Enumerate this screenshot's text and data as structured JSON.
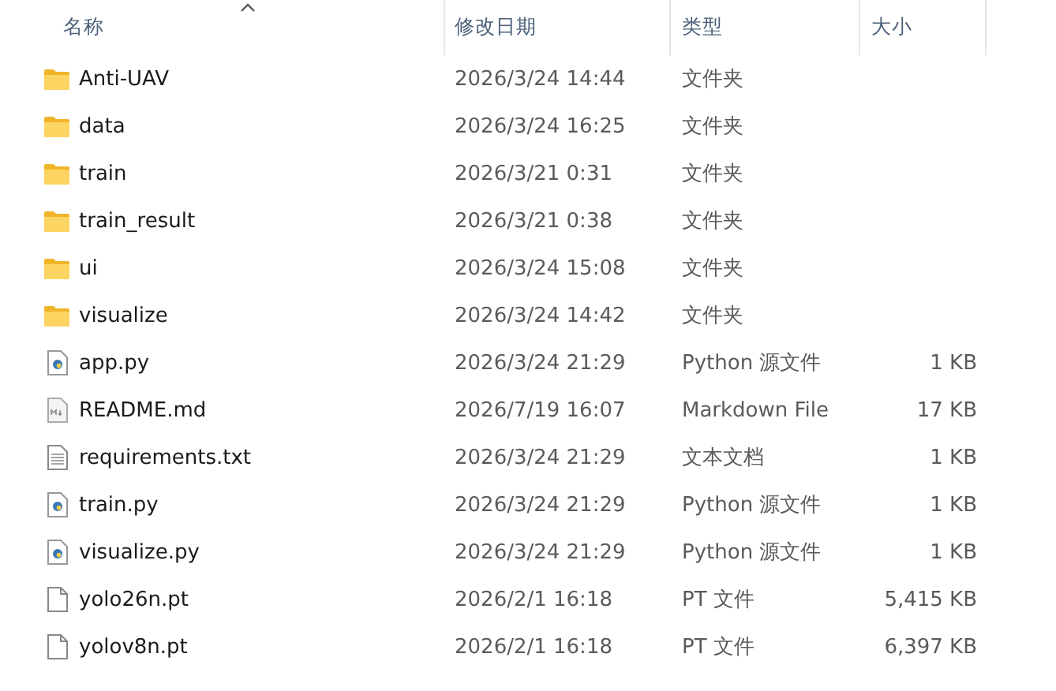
{
  "columns": [
    {
      "label": "名称",
      "sorted": true
    },
    {
      "label": "修改日期",
      "sorted": false
    },
    {
      "label": "类型",
      "sorted": false
    },
    {
      "label": "大小",
      "sorted": false
    }
  ],
  "rows": [
    {
      "kind": "folder",
      "name": "Anti-UAV",
      "date": "2026/3/24 14:44",
      "type": "文件夹"
    },
    {
      "kind": "folder",
      "name": "data",
      "date": "2026/3/24 16:25",
      "type": "文件夹"
    },
    {
      "kind": "folder",
      "name": "train",
      "date": "2026/3/21 0:31",
      "type": "文件夹"
    },
    {
      "kind": "folder",
      "name": "train_result",
      "date": "2026/3/21 0:38",
      "type": "文件夹"
    },
    {
      "kind": "folder",
      "name": "ui",
      "date": "2026/3/24 15:08",
      "type": "文件夹"
    },
    {
      "kind": "folder",
      "name": "visualize",
      "date": "2026/3/24 14:42",
      "type": "文件夹"
    },
    {
      "kind": "python",
      "name": "app.py",
      "date": "2026/3/24 21:29",
      "type": "Python 源文件",
      "size": "1 KB"
    },
    {
      "kind": "markdown",
      "name": "README.md",
      "date": "2026/7/19 16:07",
      "type": "Markdown File",
      "size": "17 KB"
    },
    {
      "kind": "text",
      "name": "requirements.txt",
      "date": "2026/3/24 21:29",
      "type": "文本文档",
      "size": "1 KB"
    },
    {
      "kind": "python",
      "name": "train.py",
      "date": "2026/3/24 21:29",
      "type": "Python 源文件",
      "size": "1 KB"
    },
    {
      "kind": "python",
      "name": "visualize.py",
      "date": "2026/3/24 21:29",
      "type": "Python 源文件",
      "size": "1 KB"
    },
    {
      "kind": "file",
      "name": "yolo26n.pt",
      "date": "2026/2/1 16:18",
      "type": "PT 文件",
      "size": "5,415 KB"
    },
    {
      "kind": "file",
      "name": "yolov8n.pt",
      "date": "2026/2/1 16:18",
      "type": "PT 文件",
      "size": "6,397 KB"
    }
  ]
}
